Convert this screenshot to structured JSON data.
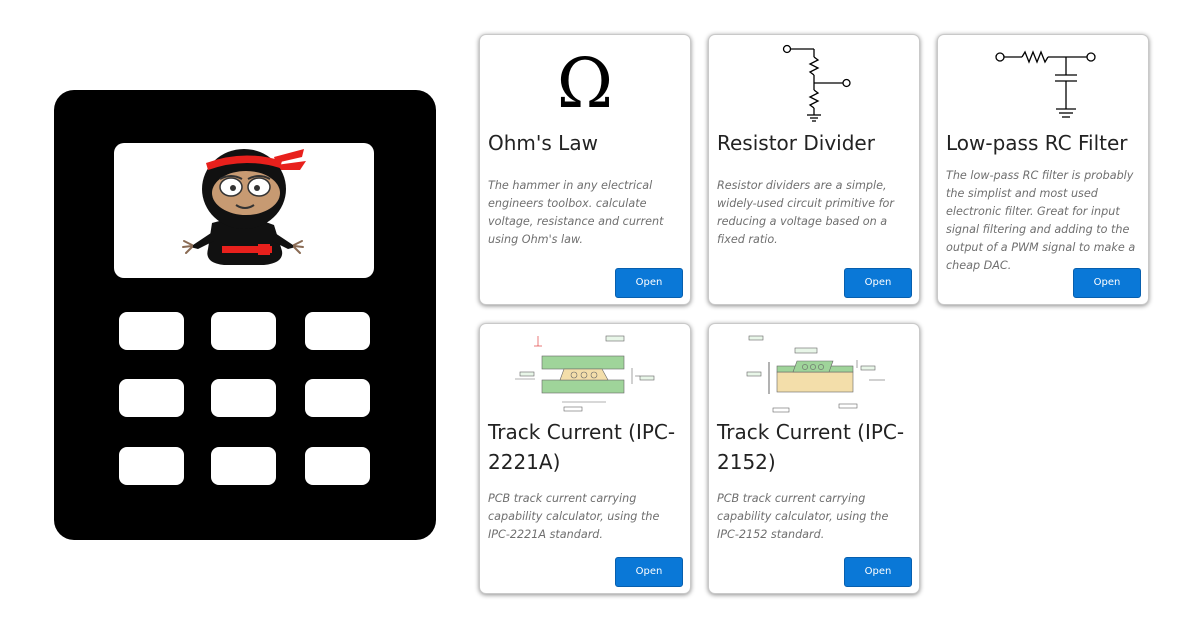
{
  "logo": {
    "brand_color": "#000000",
    "accent_color": "#e8201c",
    "icon": "ninja-calculator-icon"
  },
  "cards": [
    {
      "icon": "omega-icon",
      "symbol": "Ω",
      "title": "Ohm's Law",
      "description": "The hammer in any electrical engineers toolbox. calculate voltage, resistance and current using Ohm's law.",
      "button": "Open"
    },
    {
      "icon": "resistor-divider-schematic-icon",
      "title": "Resistor Divider",
      "description": "Resistor dividers are a simple, widely-used circuit primitive for reducing a voltage based on a fixed ratio.",
      "button": "Open"
    },
    {
      "icon": "rc-filter-schematic-icon",
      "title": "Low-pass RC Filter",
      "description": "The low-pass RC filter is probably the simplist and most used electronic filter. Great for input signal filtering and adding to the output of a PWM signal to make a cheap DAC.",
      "button": "Open"
    },
    {
      "icon": "pcb-track-ipc2221a-diagram-icon",
      "title": "Track Current (IPC-2221A)",
      "description": "PCB track current carrying capability calculator, using the IPC-2221A standard.",
      "button": "Open"
    },
    {
      "icon": "pcb-track-ipc2152-diagram-icon",
      "title": "Track Current (IPC-2152)",
      "description": "PCB track current carrying capability calculator, using the IPC-2152 standard.",
      "button": "Open"
    }
  ],
  "colors": {
    "button_bg": "#0a78d7",
    "card_border": "#c9c9c9",
    "pcb_green": "#9fd49a",
    "pcb_tan": "#f3deaa"
  }
}
